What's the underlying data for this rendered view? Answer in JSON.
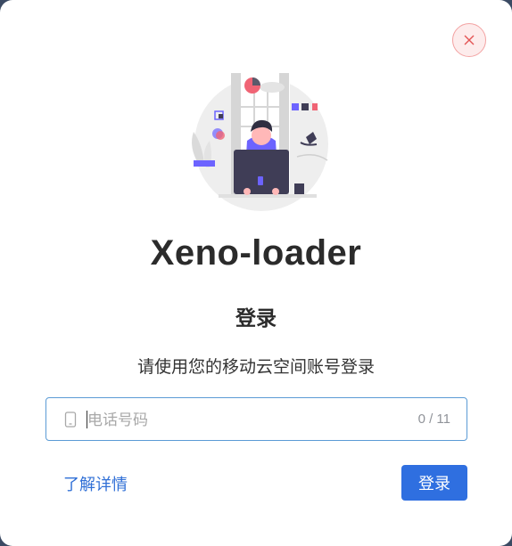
{
  "dialog": {
    "close_icon": "close-icon",
    "illustration_icon": "developer-at-laptop-illustration",
    "app_title": "Xeno-loader",
    "login_heading": "登录",
    "subtitle": "请使用您的移动云空间账号登录",
    "phone_field": {
      "icon": "mobile-phone-icon",
      "value": "",
      "placeholder": "电话号码",
      "counter": "0 / 11"
    },
    "learn_more_label": "了解详情",
    "login_button_label": "登录"
  },
  "colors": {
    "accent": "#2f6fe0",
    "link": "#2f6fd6",
    "close_bg": "#fdecec",
    "close_icon": "#e45656",
    "field_border": "#5b9bd5"
  }
}
